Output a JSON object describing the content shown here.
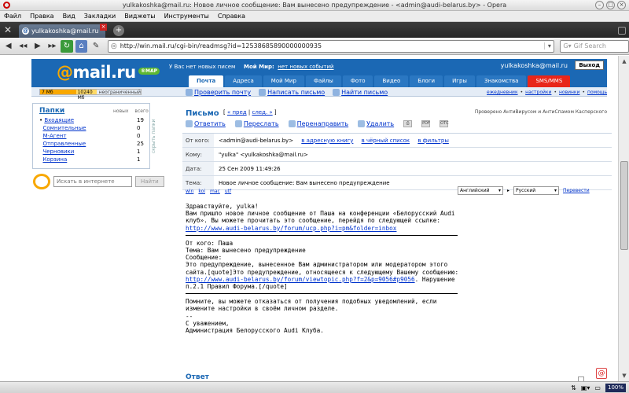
{
  "window": {
    "title": "yulkakoshka@mail.ru: Новое личное сообщение: Вам вынесено предупреждение - <admin@audi-belarus.by> - Opera"
  },
  "menu": [
    "Файл",
    "Правка",
    "Вид",
    "Закладки",
    "Виджеты",
    "Инструменты",
    "Справка"
  ],
  "tab": {
    "label": "yulkakoshka@mail.ru"
  },
  "address": {
    "url": "http://win.mail.ru/cgi-bin/readmsg?id=12538685890000000935"
  },
  "search": {
    "placeholder": "Gif Search"
  },
  "header": {
    "logo_at": "@",
    "logo_text": "mail.ru",
    "map_badge": "®МАР",
    "no_new_mail": "У Вас нет новых писем",
    "my_world_label": "Мой Мир:",
    "my_world_link": "нет новых событий",
    "user": "yulkakoshka@mail.ru",
    "exit": "Выход"
  },
  "nav_tabs": [
    {
      "label": "Почта",
      "active": true
    },
    {
      "label": "Адреса"
    },
    {
      "label": "Мой Мир"
    },
    {
      "label": "Файлы"
    },
    {
      "label": "Фото"
    },
    {
      "label": "Видео"
    },
    {
      "label": "Блоги"
    },
    {
      "label": "Игры"
    },
    {
      "label": "Знакомства"
    },
    {
      "label": "SMS/MMS",
      "red": true
    }
  ],
  "quota": {
    "used": "7 Мб",
    "total": "10240 Мб",
    "unlimited": "неограниченный",
    "used_fraction": 0.44
  },
  "toolbar": {
    "check_mail": "Проверить почту",
    "write": "Написать письмо",
    "find": "Найти письмо"
  },
  "top_links": [
    "ежедневник",
    "настройки",
    "новинки",
    "помощь"
  ],
  "folders": {
    "title": "Папки",
    "col_new": "новых",
    "col_all": "всего",
    "items": [
      {
        "name": "Входящие",
        "new": "",
        "all": "19"
      },
      {
        "name": "Сомнительные",
        "new": "",
        "all": "0"
      },
      {
        "name": "М-Агент",
        "new": "",
        "all": "0"
      },
      {
        "name": "Отправленные",
        "new": "",
        "all": "25"
      },
      {
        "name": "Черновики",
        "new": "",
        "all": "1"
      },
      {
        "name": "Корзина",
        "new": "",
        "all": "1"
      }
    ],
    "collapse": "скрыть папки"
  },
  "internet_search": {
    "placeholder": "Искать в интернете",
    "button": "Найти"
  },
  "letter": {
    "title": "Письмо",
    "prev": "« пред",
    "next": "след. »",
    "checked": "Проверено АнтиВирусом и АнтиСпамом Касперского",
    "actions": [
      "Ответить",
      "Переслать",
      "Перенаправить",
      "Удалить"
    ],
    "action_badges": [
      "PDF",
      "ОТС"
    ],
    "headers": {
      "from_label": "От кого:",
      "from_value": "<admin@audi-belarus.by>",
      "from_links": [
        "в адресную книгу",
        "в чёрный список",
        "в фильтры"
      ],
      "to_label": "Кому:",
      "to_value": "\"yulka\" <yulkakoshka@mail.ru>",
      "date_label": "Дата:",
      "date_value": "25 Сен 2009 11:49:26",
      "subject_label": "Тема:",
      "subject_value": "Новое личное сообщение: Вам вынесено предупреждение"
    },
    "encodings": [
      "win",
      "koi",
      "mac",
      "utf"
    ],
    "translate_from": "Английский",
    "translate_to": "Русский",
    "translate_btn": "Перевести",
    "body": {
      "p1": "Здравствуйте, yulka!\nВам пришло новое личное сообщение от Паша на конференции «Белорусский Audi\nклуб». Вы можете прочитать это сообщение, перейдя по следующей ссылке:",
      "link1": "http://www.audi-belarus.by/forum/ucp.php?i=pm&folder=inbox",
      "p2": "От кого: Паша\nТема: Вам вынесено предупреждение\nСообщение:\nЭто предупреждение, вынесенное Вам администратором или модератором этого\nсайта.[quote]Это предупреждение, относящееся к следующему Вашему сообщению:",
      "link2": "http://www.audi-belarus.by/forum/viewtopic.php?f=2&p=9056#p9056",
      "p2b": ". Нарушение\nп.2.1 Правил Форума.[/quote]",
      "p3": "Помните, вы можете отказаться от получения подобных уведомлений, если\nизмените настройки в своём личном разделе.\n--\nС уважением,\nАдминистрация Белорусского Audi Клуба."
    },
    "reply": "Ответ"
  },
  "status": {
    "zoom": "100%"
  }
}
